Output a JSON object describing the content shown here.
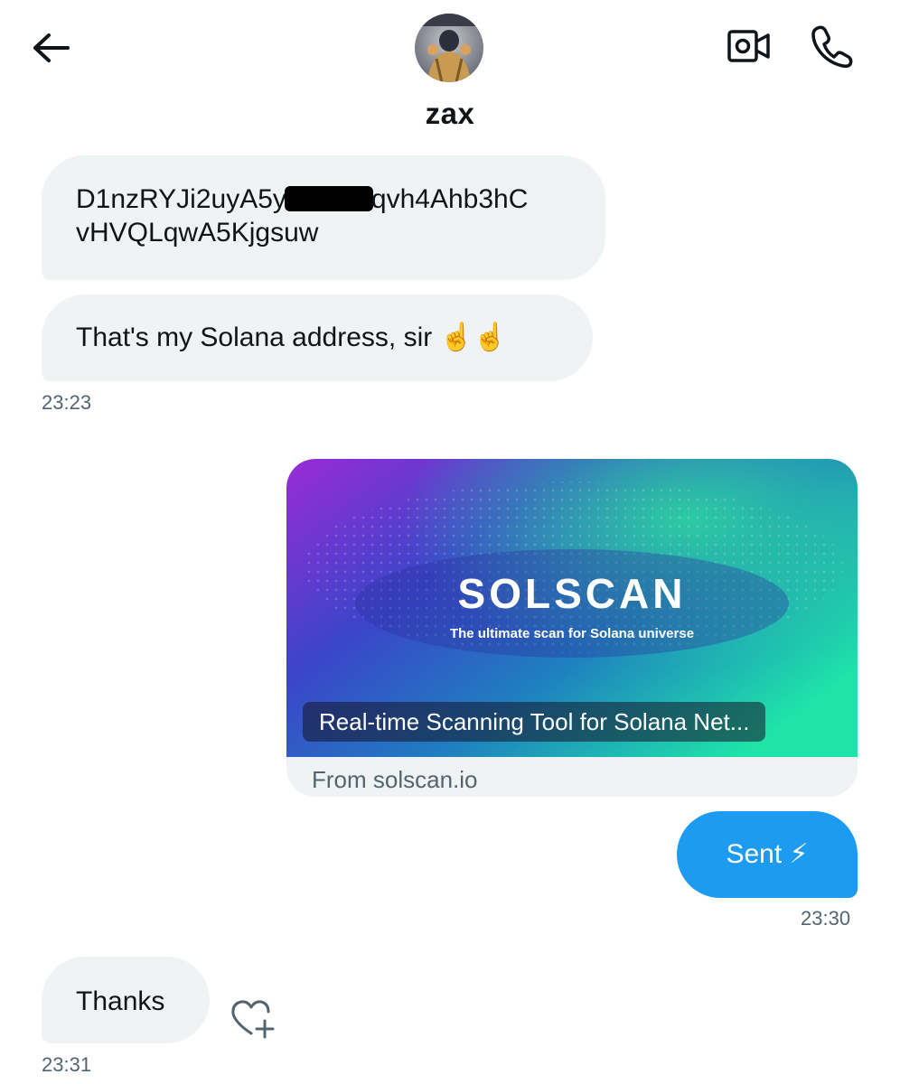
{
  "header": {
    "name": "zax",
    "back_icon": "arrow-left-icon",
    "video_icon": "video-call-icon",
    "call_icon": "phone-icon"
  },
  "messages": {
    "address_part1": "D1nzRYJi2uyA5y",
    "address_part2": "qvh4Ahb3hC",
    "address_line2": "vHVQLqwA5Kjgsuw",
    "solana_text": "That's my Solana address, sir ☝️☝️",
    "time1": "23:23",
    "link_card": {
      "logo_text": "SOLSCAN",
      "tagline": "The ultimate scan for Solana universe",
      "title": "Real-time Scanning Tool for Solana Net...",
      "source": "From solscan.io"
    },
    "sent_text": "Sent ⚡",
    "time2": "23:30",
    "thanks_text": "Thanks",
    "time3": "23:31"
  },
  "colors": {
    "accent": "#1d9bf0",
    "bubble_in": "#eff3f4",
    "meta_text": "#536471"
  }
}
